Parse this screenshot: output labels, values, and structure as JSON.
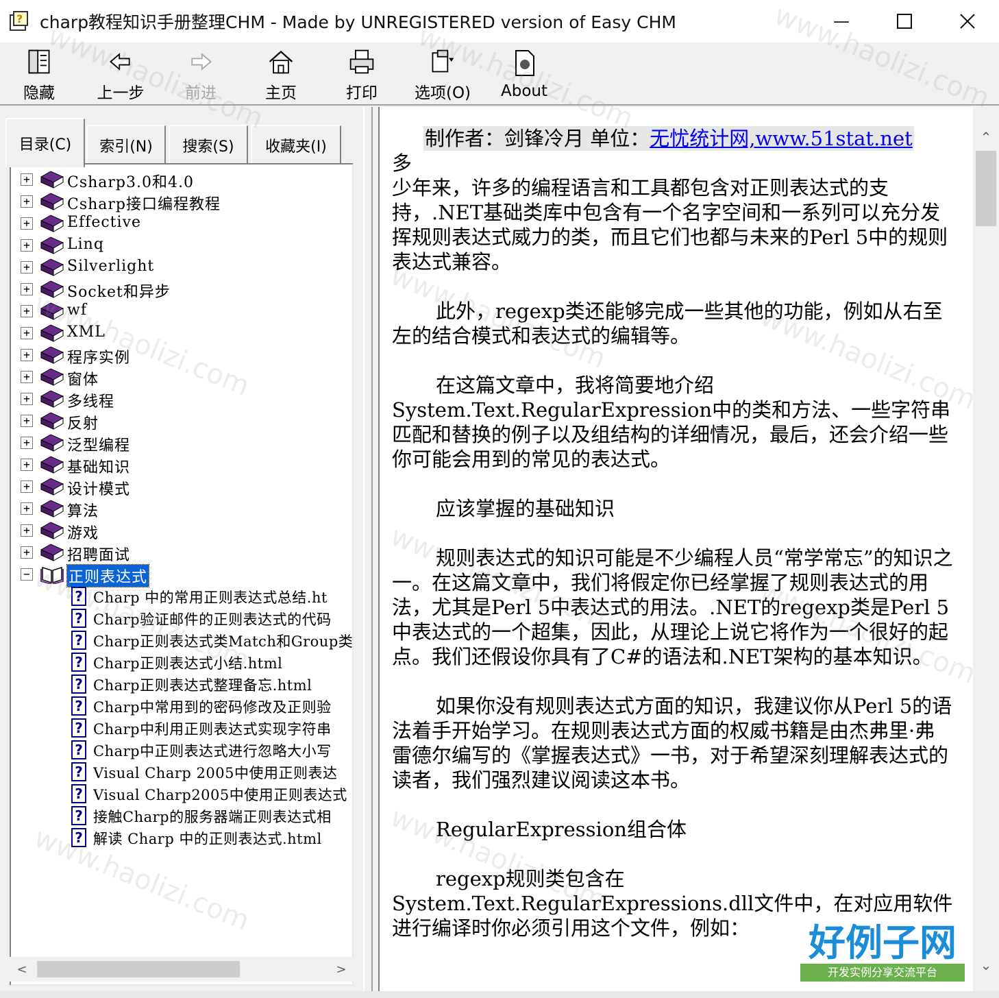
{
  "window": {
    "title": "charp教程知识手册整理CHM - Made by UNREGISTERED version of Easy CHM",
    "minimize_glyph": "—",
    "maximize_glyph": "☐",
    "close_glyph": "✕"
  },
  "toolbar": {
    "hide_label": "隐藏",
    "back_label": "上一步",
    "forward_label": "前进",
    "home_label": "主页",
    "print_label": "打印",
    "options_label": "选项(O)",
    "about_label": "About"
  },
  "tabs": {
    "contents": "目录(C)",
    "index": "索引(N)",
    "search": "搜索(S)",
    "favorites": "收藏夹(I)"
  },
  "tree": {
    "books": [
      {
        "label": "Csharp3.0和4.0",
        "expander": "+"
      },
      {
        "label": "Csharp接口编程教程",
        "expander": "+"
      },
      {
        "label": "Effective",
        "expander": "+"
      },
      {
        "label": "Linq",
        "expander": "+"
      },
      {
        "label": "Silverlight",
        "expander": "+"
      },
      {
        "label": "Socket和异步",
        "expander": "+"
      },
      {
        "label": "wf",
        "expander": "+"
      },
      {
        "label": "XML",
        "expander": "+"
      },
      {
        "label": "程序实例",
        "expander": "+"
      },
      {
        "label": "窗体",
        "expander": "+"
      },
      {
        "label": "多线程",
        "expander": "+"
      },
      {
        "label": "反射",
        "expander": "+"
      },
      {
        "label": "泛型编程",
        "expander": "+"
      },
      {
        "label": "基础知识",
        "expander": "+"
      },
      {
        "label": "设计模式",
        "expander": "+"
      },
      {
        "label": "算法",
        "expander": "+"
      },
      {
        "label": "游戏",
        "expander": "+"
      },
      {
        "label": "招聘面试",
        "expander": "+"
      },
      {
        "label": "正则表达式",
        "expander": "−"
      }
    ],
    "pages": [
      "Charp 中的常用正则表达式总结.ht",
      "Charp验证邮件的正则表达式的代码",
      "Charp正则表达式类Match和Group类",
      "Charp正则表达式小结.html",
      "Charp正则表达式整理备忘.html",
      "Charp中常用到的密码修改及正则验",
      "Charp中利用正则表达式实现字符串",
      "Charp中正则表达式进行忽略大小写",
      "Visual Charp 2005中使用正则表达",
      "Visual Charp2005中使用正则表达式",
      "接触Charp的服务器端正则表达式相",
      "解读 Charp 中的正则表达式.html"
    ],
    "page_glyph": "?",
    "scroll_left": "<",
    "scroll_right": ">"
  },
  "content": {
    "author_prefix": "制作者：剑锋冷月 单位：",
    "author_link": "无忧统计网,www.51stat.net",
    "p1_lead": "多",
    "p1": "少年来，许多的编程语言和工具都包含对正则表达式的支持，.NET基础类库中包含有一个名字空间和一系列可以充分发挥规则表达式威力的类，而且它们也都与未来的Perl 5中的规则表达式兼容。",
    "p2": "此外，regexp类还能够完成一些其他的功能，例如从右至左的结合模式和表达式的编辑等。",
    "p3": "在这篇文章中，我将简要地介绍System.Text.RegularExpression中的类和方法、一些字符串匹配和替换的例子以及组结构的详细情况，最后，还会介绍一些你可能会用到的常见的表达式。",
    "p4": "应该掌握的基础知识",
    "p5": "规则表达式的知识可能是不少编程人员“常学常忘”的知识之一。在这篇文章中，我们将假定你已经掌握了规则表达式的用法，尤其是Perl 5中表达式的用法。.NET的regexp类是Perl 5中表达式的一个超集，因此，从理论上说它将作为一个很好的起点。我们还假设你具有了C#的语法和.NET架构的基本知识。",
    "p6": "如果你没有规则表达式方面的知识，我建议你从Perl 5的语法着手开始学习。在规则表达式方面的权威书籍是由杰弗里·弗雷德尔编写的《掌握表达式》一书，对于希望深刻理解表达式的读者，我们强烈建议阅读这本书。",
    "p7": "RegularExpression组合体",
    "p8": "regexp规则类包含在System.Text.RegularExpressions.dll文件中，在对应用软件进行编译时你必须引用这个文件，例如：",
    "scroll_up": "⌃",
    "scroll_down": "⌄"
  },
  "watermark": {
    "text": "www.haolizi.com",
    "logo_main": "好例子网",
    "logo_sub": "开发实例分享交流平台"
  },
  "colors": {
    "selection": "#0a64d8",
    "link": "#0000ee",
    "book": "#6b2a8c",
    "page_icon": "#000080"
  }
}
